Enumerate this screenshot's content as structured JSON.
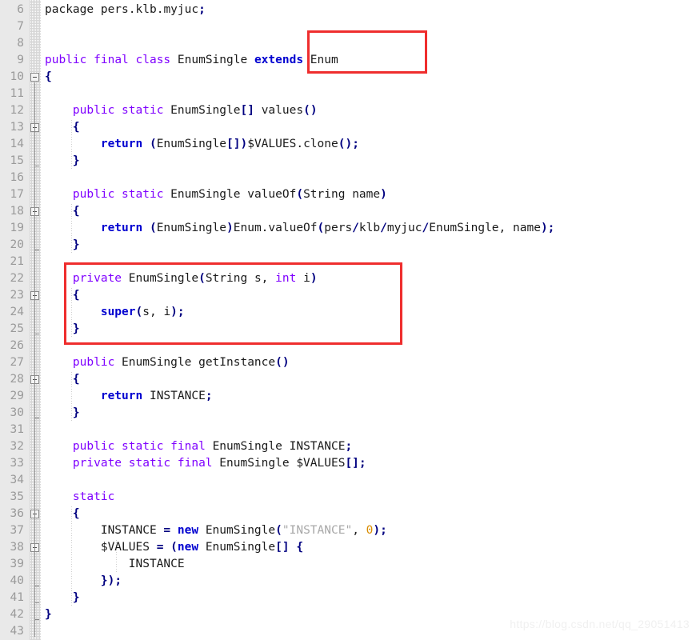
{
  "editor": {
    "language": "java",
    "first_line": 6,
    "last_line": 43,
    "colors": {
      "background": "#ffffff",
      "gutter_background": "#e9e9e9",
      "line_number": "#9a9a9a",
      "keyword": "#7f00ff",
      "keyword_bold": "#0000d0",
      "operator": "#000080",
      "identifier": "#1a1a1a",
      "string": "#a8a8a8",
      "number": "#d98c00",
      "annotation_box": "#ef2d2d"
    }
  },
  "lines": [
    {
      "no": "6",
      "fold": "none",
      "text": "package pers.klb.myjuc;"
    },
    {
      "no": "7",
      "fold": "none",
      "text": ""
    },
    {
      "no": "8",
      "fold": "none",
      "text": ""
    },
    {
      "no": "9",
      "fold": "none",
      "text": "public final class EnumSingle extends Enum"
    },
    {
      "no": "10",
      "fold": "open",
      "text": "{"
    },
    {
      "no": "11",
      "fold": "bar",
      "text": ""
    },
    {
      "no": "12",
      "fold": "bar",
      "text": "    public static EnumSingle[] values()"
    },
    {
      "no": "13",
      "fold": "open",
      "text": "    {"
    },
    {
      "no": "14",
      "fold": "bar",
      "text": "        return (EnumSingle[])$VALUES.clone();"
    },
    {
      "no": "15",
      "fold": "end",
      "text": "    }"
    },
    {
      "no": "16",
      "fold": "bar",
      "text": ""
    },
    {
      "no": "17",
      "fold": "bar",
      "text": "    public static EnumSingle valueOf(String name)"
    },
    {
      "no": "18",
      "fold": "open",
      "text": "    {"
    },
    {
      "no": "19",
      "fold": "bar",
      "text": "        return (EnumSingle)Enum.valueOf(pers/klb/myjuc/EnumSingle, name);"
    },
    {
      "no": "20",
      "fold": "end",
      "text": "    }"
    },
    {
      "no": "21",
      "fold": "bar",
      "text": ""
    },
    {
      "no": "22",
      "fold": "bar",
      "text": "    private EnumSingle(String s, int i)"
    },
    {
      "no": "23",
      "fold": "open",
      "text": "    {"
    },
    {
      "no": "24",
      "fold": "bar",
      "text": "        super(s, i);"
    },
    {
      "no": "25",
      "fold": "end",
      "text": "    }"
    },
    {
      "no": "26",
      "fold": "bar",
      "text": ""
    },
    {
      "no": "27",
      "fold": "bar",
      "text": "    public EnumSingle getInstance()"
    },
    {
      "no": "28",
      "fold": "open",
      "text": "    {"
    },
    {
      "no": "29",
      "fold": "bar",
      "text": "        return INSTANCE;"
    },
    {
      "no": "30",
      "fold": "end",
      "text": "    }"
    },
    {
      "no": "31",
      "fold": "bar",
      "text": ""
    },
    {
      "no": "32",
      "fold": "bar",
      "text": "    public static final EnumSingle INSTANCE;"
    },
    {
      "no": "33",
      "fold": "bar",
      "text": "    private static final EnumSingle $VALUES[];"
    },
    {
      "no": "34",
      "fold": "bar",
      "text": ""
    },
    {
      "no": "35",
      "fold": "bar",
      "text": "    static"
    },
    {
      "no": "36",
      "fold": "open",
      "text": "    {"
    },
    {
      "no": "37",
      "fold": "bar",
      "text": "        INSTANCE = new EnumSingle(\"INSTANCE\", 0);"
    },
    {
      "no": "38",
      "fold": "open",
      "text": "        $VALUES = (new EnumSingle[] {"
    },
    {
      "no": "39",
      "fold": "bar",
      "text": "            INSTANCE"
    },
    {
      "no": "40",
      "fold": "end",
      "text": "        });"
    },
    {
      "no": "41",
      "fold": "end",
      "text": "    }"
    },
    {
      "no": "42",
      "fold": "end",
      "text": "}"
    },
    {
      "no": "43",
      "fold": "none",
      "text": ""
    }
  ],
  "annotations": [
    {
      "id": "extends-enum-highlight",
      "label": "extends Enum",
      "color": "#ef2d2d"
    },
    {
      "id": "private-constructor-highlight",
      "label": "private EnumSingle(String s, int i) { super(s, i); }",
      "color": "#ef2d2d"
    }
  ],
  "watermark": {
    "text": "https://blog.csdn.net/qq_29051413"
  }
}
